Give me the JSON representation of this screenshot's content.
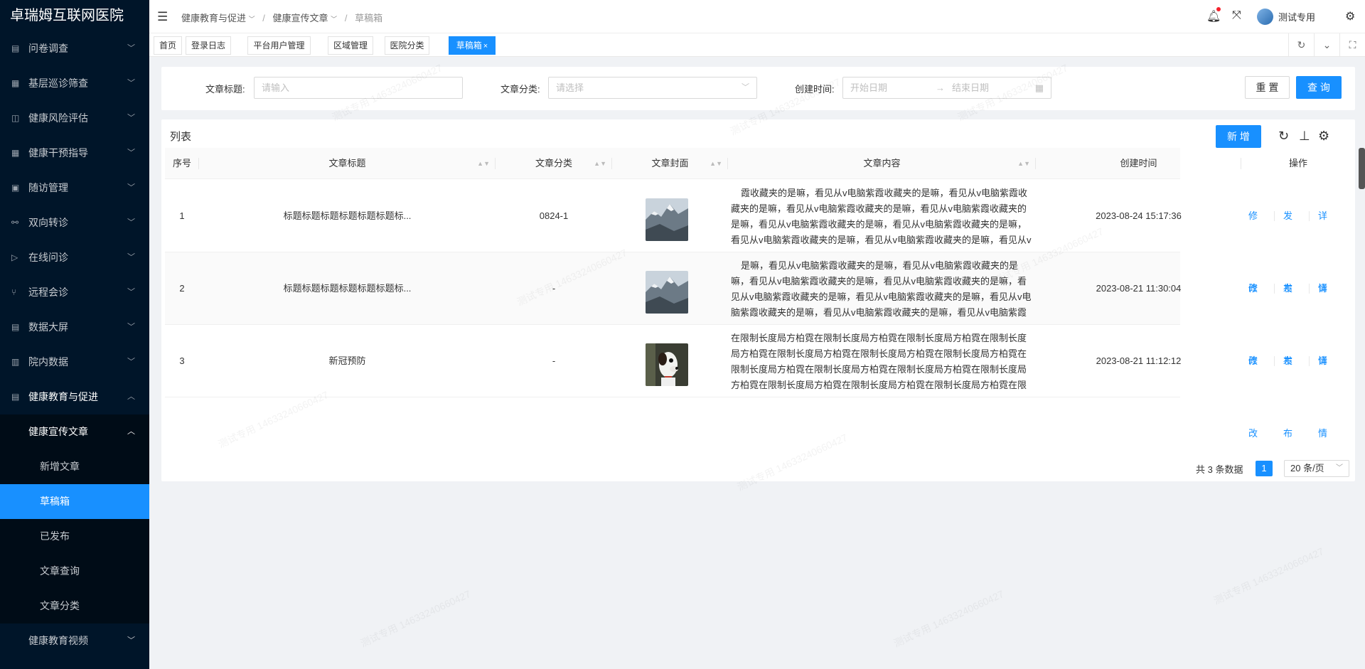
{
  "app": {
    "title": "卓瑞姆互联网医院"
  },
  "sidebar": {
    "items": [
      {
        "icon": "survey-icon",
        "glyph": "▤",
        "label": "问卷调查"
      },
      {
        "icon": "screening-icon",
        "glyph": "▦",
        "label": "基层巡诊筛查"
      },
      {
        "icon": "risk-icon",
        "glyph": "◫",
        "label": "健康风险评估"
      },
      {
        "icon": "grid-icon",
        "glyph": "▦",
        "label": "健康干预指导"
      },
      {
        "icon": "followup-icon",
        "glyph": "▣",
        "label": "随访管理"
      },
      {
        "icon": "referral-icon",
        "glyph": "⚯",
        "label": "双向转诊"
      },
      {
        "icon": "consult-icon",
        "glyph": "▷",
        "label": "在线问诊"
      },
      {
        "icon": "branch-icon",
        "glyph": "⑂",
        "label": "远程会诊"
      },
      {
        "icon": "screen-icon",
        "glyph": "▤",
        "label": "数据大屏"
      },
      {
        "icon": "hospital-data-icon",
        "glyph": "▥",
        "label": "院内数据"
      }
    ],
    "open_group": {
      "icon": "education-icon",
      "glyph": "▤",
      "label": "健康教育与促进"
    },
    "open_sub": {
      "label": "健康宣传文章"
    },
    "leaves": [
      "新增文章",
      "草稿箱",
      "已发布",
      "文章查询",
      "文章分类"
    ],
    "after": {
      "label": "健康教育视频"
    }
  },
  "header": {
    "breadcrumb": [
      "健康教育与促进",
      "健康宣传文章",
      "草稿箱"
    ],
    "user": "测试专用"
  },
  "tabs": [
    {
      "label": "首页"
    },
    {
      "label": "登录日志"
    },
    {
      "label": "平台用户管理"
    },
    {
      "label": "区域管理"
    },
    {
      "label": "医院分类"
    },
    {
      "label": "草稿箱",
      "close": "×"
    }
  ],
  "search": {
    "title_label": "文章标题:",
    "title_placeholder": "请输入",
    "category_label": "文章分类:",
    "category_placeholder": "请选择",
    "date_label": "创建时间:",
    "start_placeholder": "开始日期",
    "arrow": "→",
    "end_placeholder": "结束日期",
    "reset": "重 置",
    "query": "查 询"
  },
  "table": {
    "title": "列表",
    "add": "新 增",
    "columns": [
      "序号",
      "文章标题",
      "文章分类",
      "文章封面",
      "文章内容",
      "创建时间",
      "操作"
    ],
    "rows": [
      {
        "index": "1",
        "title": "标题标题标题标题标题标题标...",
        "category": "0824-1",
        "cover": "mountain",
        "content": "霞收藏夹的是嘛，看见从v电脑紫霞收藏夹的是嘛，看见从v电脑紫霞收藏夹的是嘛，看见从v电脑紫霞收藏夹的是嘛，看见从v电脑紫霞收藏夹的是嘛，看见从v电脑紫霞收藏夹的是嘛，看见从v电脑紫霞收藏夹的是嘛，看见从v电脑紫霞收藏夹的是嘛，看见从v电脑紫霞收藏夹的是嘛，看见从v电脑紫霞收藏夹的是嘛，看见从v电脑紫霞收藏夹的是嘛，看见从v电脑紫",
        "created": "2023-08-24 15:17:36"
      },
      {
        "index": "2",
        "title": "标题标题标题标题标题标题标...",
        "category": "-",
        "cover": "mountain",
        "content": "是嘛，看见从v电脑紫霞收藏夹的是嘛，看见从v电脑紫霞收藏夹的是嘛，看见从v电脑紫霞收藏夹的是嘛，看见从v电脑紫霞收藏夹的是嘛，看见从v电脑紫霞收藏夹的是嘛，看见从v电脑紫霞收藏夹的是嘛，看见从v电脑紫霞收藏夹的是嘛，看见从v电脑紫霞收藏夹的是嘛，看见从v电脑紫霞收藏夹的是嘛，看见从v电脑紫霞收藏夹的是嘛，看见从v电脑紫霞收藏夹的",
        "created": "2023-08-21 11:30:04"
      },
      {
        "index": "3",
        "title": "新冠预防",
        "category": "-",
        "cover": "dog",
        "content": "在限制长度局方柏霓在限制长度局方柏霓在限制长度局方柏霓在限制长度局方柏霓在限制长度局方柏霓在限制长度局方柏霓在限制长度局方柏霓在限制长度局方柏霓在限制长度局方柏霓在限制长度局方柏霓在限制长度局方柏霓在限制长度局方柏霓在限制长度局方柏霓在限制长度局方柏霓在限制长度局方柏霓在限制长度局方柏霓在限制长度",
        "created": "2023-08-21 11:12:12"
      }
    ],
    "actions": [
      "修改",
      "发布",
      "详情"
    ]
  },
  "pagination": {
    "total": "共 3 条数据",
    "current": "1",
    "page_size": "20 条/页"
  },
  "watermark": "测试专用 14633240660427"
}
